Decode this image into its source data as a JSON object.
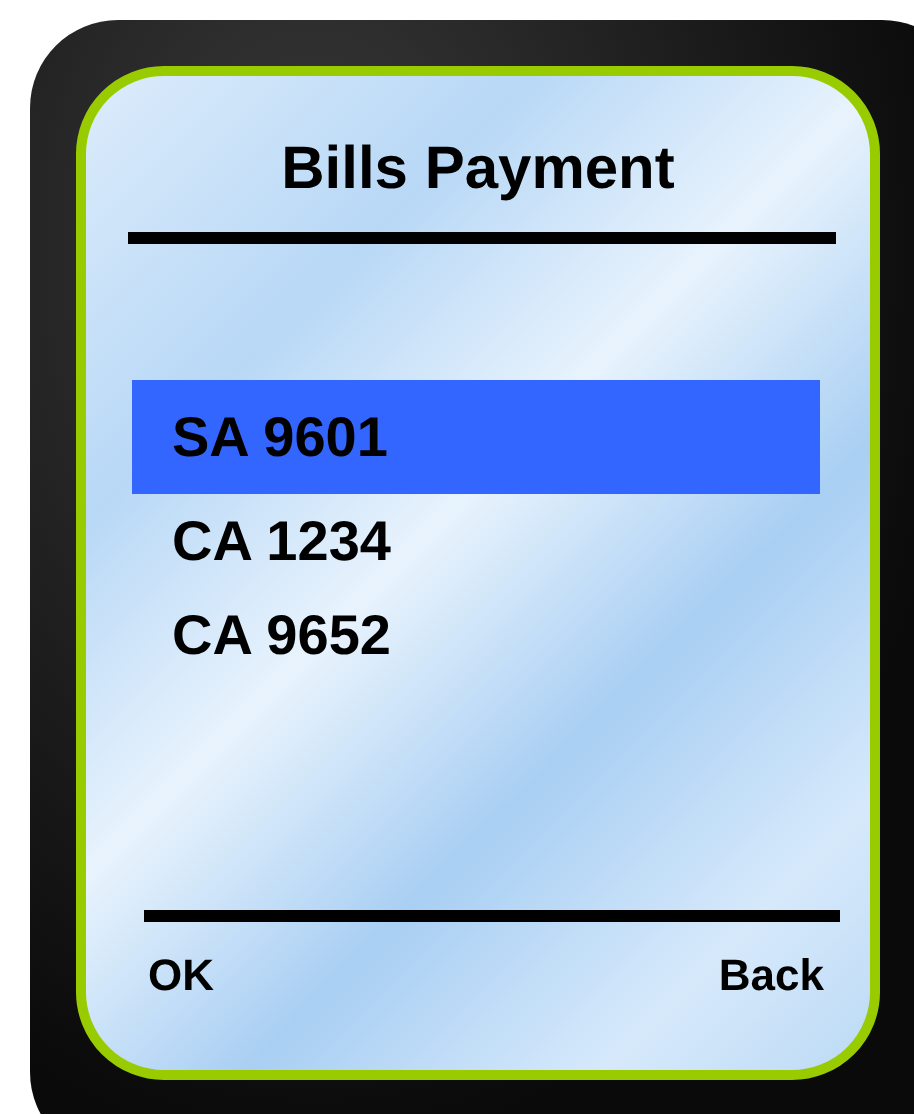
{
  "title": "Bills Payment",
  "accounts": [
    {
      "label": "SA 9601",
      "selected": true
    },
    {
      "label": "CA 1234",
      "selected": false
    },
    {
      "label": "CA 9652",
      "selected": false
    }
  ],
  "softkeys": {
    "left": "OK",
    "right": "Back"
  }
}
